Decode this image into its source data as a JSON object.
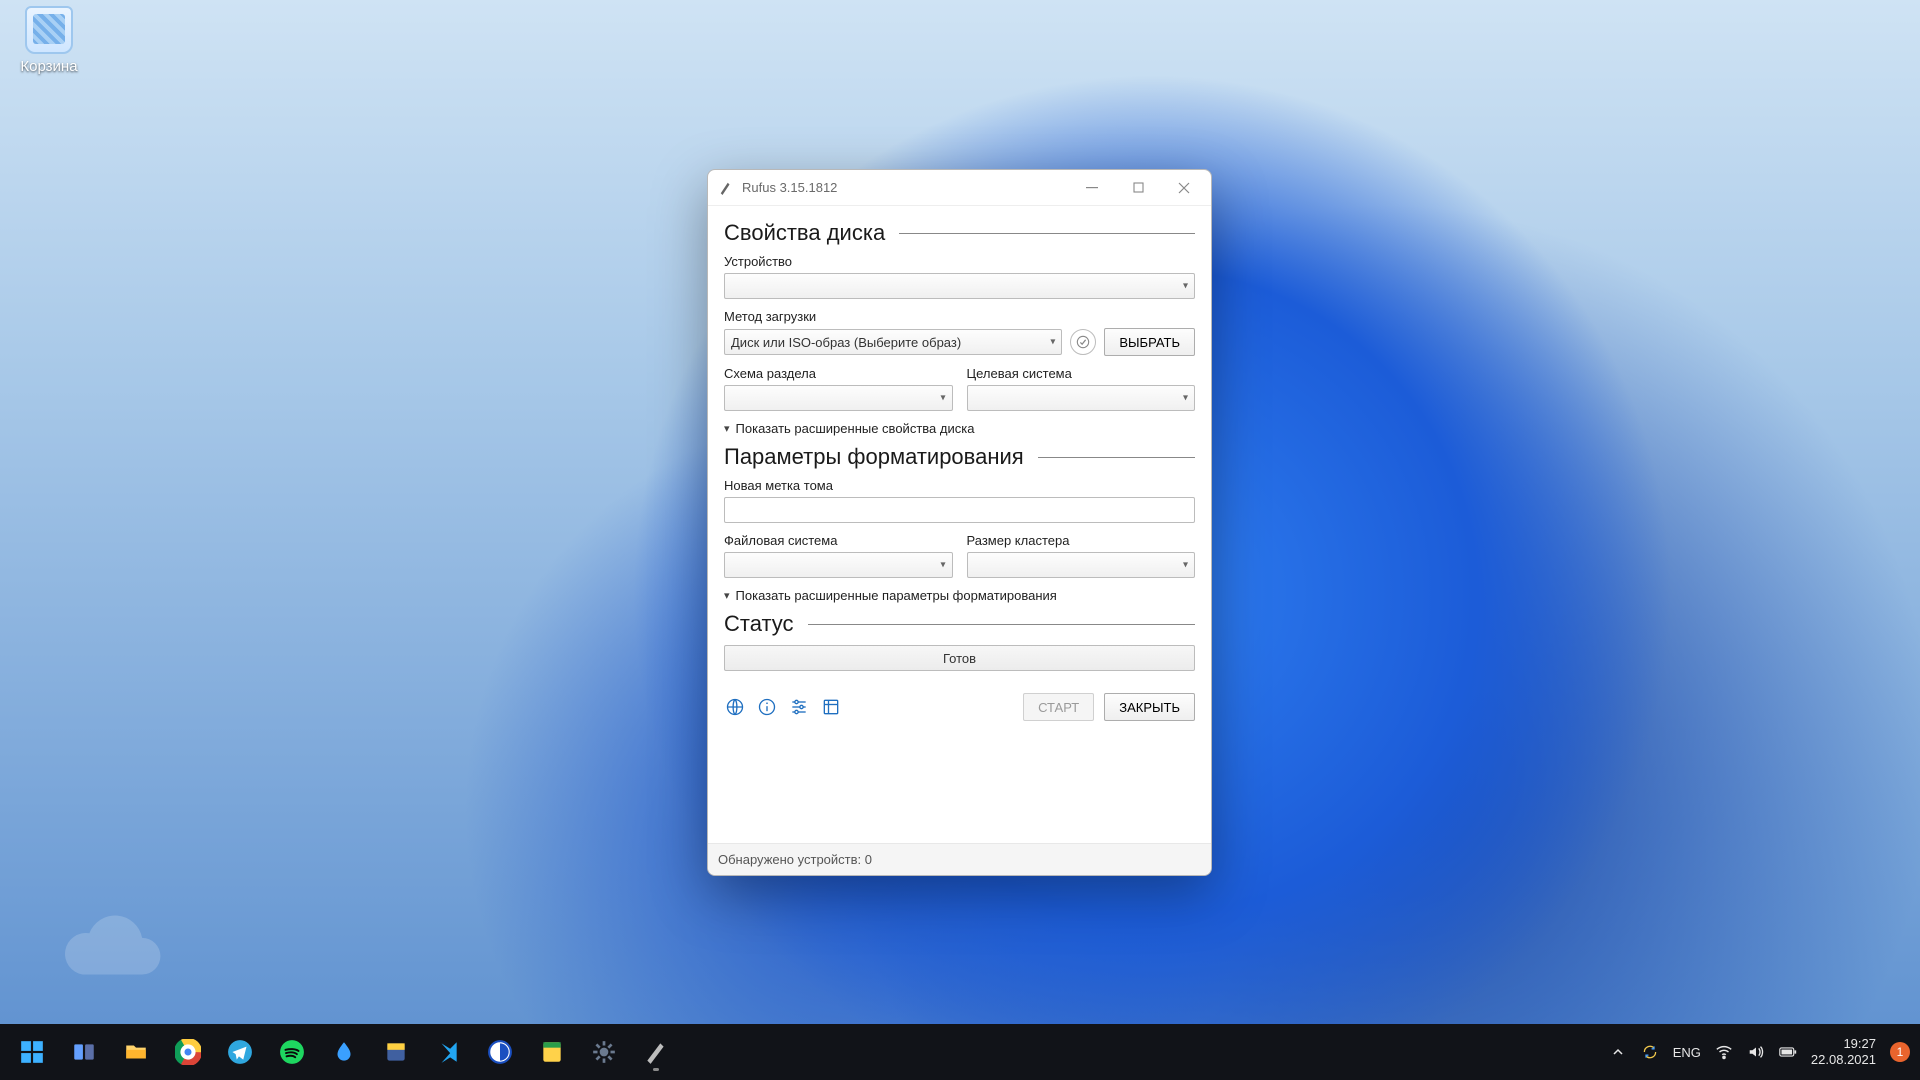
{
  "desktop": {
    "recycle_bin_label": "Корзина"
  },
  "window": {
    "title": "Rufus 3.15.1812",
    "sections": {
      "drive_props": "Свойства диска",
      "format_opts": "Параметры форматирования",
      "status": "Статус"
    },
    "labels": {
      "device": "Устройство",
      "boot_method": "Метод загрузки",
      "partition_scheme": "Схема раздела",
      "target_system": "Целевая система",
      "show_adv_drive": "Показать расширенные свойства диска",
      "volume_label": "Новая метка тома",
      "file_system": "Файловая система",
      "cluster_size": "Размер кластера",
      "show_adv_format": "Показать расширенные параметры форматирования"
    },
    "values": {
      "device": "",
      "boot_method": "Диск или ISO-образ (Выберите образ)",
      "partition_scheme": "",
      "target_system": "",
      "volume_label": "",
      "file_system": "",
      "cluster_size": "",
      "status": "Готов"
    },
    "buttons": {
      "select": "ВЫБРАТЬ",
      "start": "СТАРТ",
      "close": "ЗАКРЫТЬ"
    },
    "footer": "Обнаружено устройств: 0"
  },
  "taskbar": {
    "lang": "ENG",
    "time": "19:27",
    "date": "22.08.2021",
    "notifications": "1"
  }
}
